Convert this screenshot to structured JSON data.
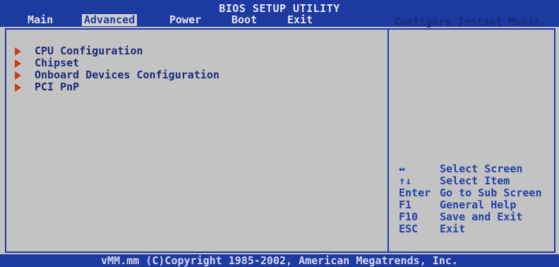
{
  "header": {
    "title": "BIOS SETUP UTILITY",
    "tabs": [
      {
        "label": "Main"
      },
      {
        "label": "Advanced"
      },
      {
        "label": "Power"
      },
      {
        "label": "Boot"
      },
      {
        "label": "Exit"
      }
    ],
    "active_tab": "Advanced"
  },
  "menu": {
    "items": [
      {
        "label": "CPU Configuration"
      },
      {
        "label": "Chipset"
      },
      {
        "label": "Onboard Devices Configuration"
      },
      {
        "label": "PCI PnP"
      }
    ]
  },
  "help": {
    "text": "Configure Instant Music."
  },
  "keys": [
    {
      "key": "↔",
      "desc": "Select Screen"
    },
    {
      "key": "↑↓",
      "desc": "Select Item"
    },
    {
      "key": "Enter",
      "desc": "Go to Sub Screen"
    },
    {
      "key": "F1",
      "desc": "General Help"
    },
    {
      "key": "F10",
      "desc": "Save and Exit"
    },
    {
      "key": "ESC",
      "desc": "Exit"
    }
  ],
  "footer": {
    "text": "vMM.mm (C)Copyright 1985-2002, American Megatrends, Inc."
  },
  "colors": {
    "frame_blue": "#1d3aa0",
    "panel_gray": "#c3c3c3",
    "arrow_red": "#d23a12"
  }
}
